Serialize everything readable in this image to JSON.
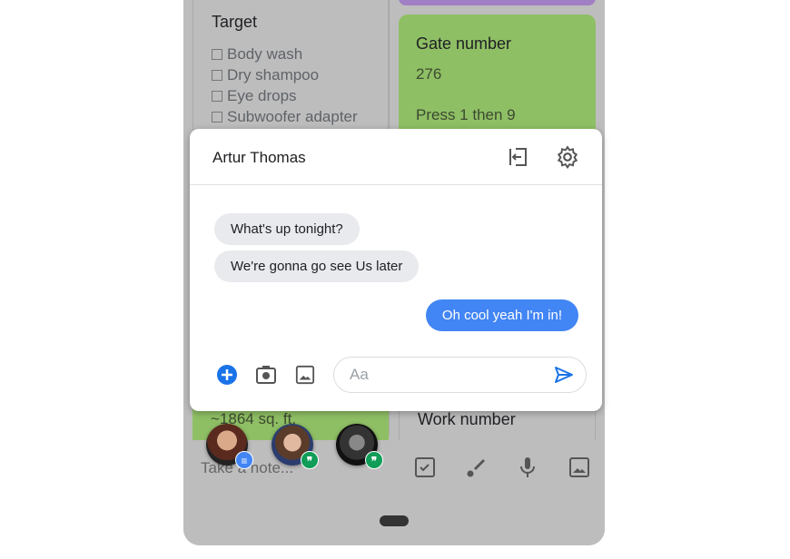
{
  "notes": {
    "target": {
      "title": "Target",
      "items": [
        "Body wash",
        "Dry shampoo",
        "Eye drops",
        "Subwoofer adapter"
      ]
    },
    "gate": {
      "title": "Gate number",
      "line1": "276",
      "line2": "Press 1 then 9"
    },
    "area": {
      "text": "~1864 sq. ft."
    },
    "work": {
      "title": "Work number"
    }
  },
  "chat": {
    "contact_name": "Artur Thomas",
    "messages": [
      {
        "from": "them",
        "text": "What's up tonight?"
      },
      {
        "from": "them",
        "text": "We're gonna go see Us later"
      },
      {
        "from": "me",
        "text": "Oh cool yeah I'm in!"
      }
    ],
    "input_placeholder": "Aa"
  },
  "bottom_bar": {
    "placeholder": "Take a note..."
  },
  "colors": {
    "accent": "#4285f4",
    "note_green": "#8fbf65",
    "note_purple": "#a07fc4",
    "hangouts_green": "#0f9d58"
  }
}
